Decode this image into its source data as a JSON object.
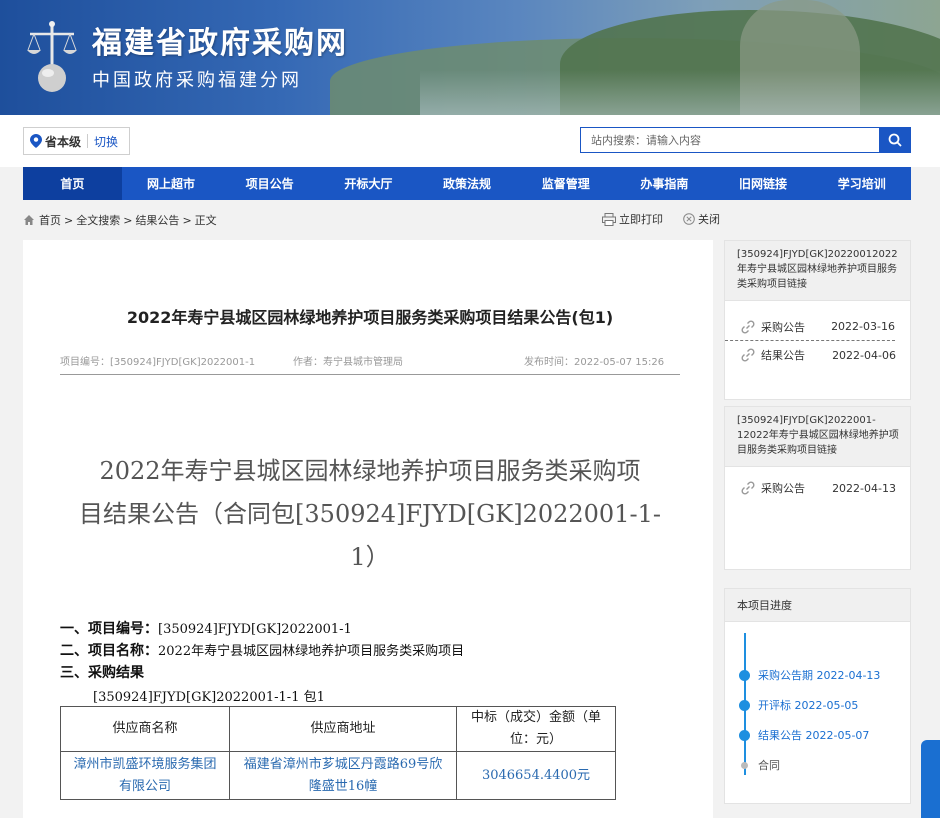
{
  "header": {
    "title": "福建省政府采购网",
    "subtitle": "中国政府采购福建分网"
  },
  "region": {
    "level": "省本级",
    "switch_label": "切换"
  },
  "search": {
    "placeholder": "站内搜索：请输入内容"
  },
  "nav": [
    {
      "label": "首页"
    },
    {
      "label": "网上超市"
    },
    {
      "label": "项目公告"
    },
    {
      "label": "开标大厅"
    },
    {
      "label": "政策法规"
    },
    {
      "label": "监督管理"
    },
    {
      "label": "办事指南"
    },
    {
      "label": "旧网链接"
    },
    {
      "label": "学习培训"
    }
  ],
  "breadcrumb": {
    "home": "首页",
    "sep": ">",
    "c1": "全文搜索",
    "c2": "结果公告",
    "c3": "正文"
  },
  "actions": {
    "print": "立即打印",
    "close": "关闭"
  },
  "article": {
    "title": "2022年寿宁县城区园林绿地养护项目服务类采购项目结果公告(包1)",
    "project_no_label": "项目编号：",
    "project_no": "[350924]FJYD[GK]2022001-1",
    "author_label": "作者：",
    "author": "寿宁县城市管理局",
    "published_label": "发布时间：",
    "published": "2022-05-07 15:26",
    "big_title_l1": "2022年寿宁县城区园林绿地养护项目服务类采购项",
    "big_title_l2": "目结果公告（合同包[350924]FJYD[GK]2022001-1-",
    "big_title_l3": "1）",
    "sec1_label": "一、项目编号：",
    "sec1_value": "[350924]FJYD[GK]2022001-1",
    "sec2_label": "二、项目名称：",
    "sec2_value": "2022年寿宁县城区园林绿地养护项目服务类采购项目",
    "sec3_label": "三、采购结果",
    "package": "[350924]FJYD[GK]2022001-1-1 包1",
    "table": {
      "h1": "供应商名称",
      "h2": "供应商地址",
      "h3_l1": "中标（成交）金额（单",
      "h3_l2": "位：元）",
      "r_name_l1": "漳州市凯盛环境服务集团",
      "r_name_l2": "有限公司",
      "r_addr_l1": "福建省漳州市芗城区丹霞路69号欣",
      "r_addr_l2": "隆盛世16幢",
      "r_amount": "3046654.4400元"
    }
  },
  "sidebar": {
    "card1": {
      "head": "[350924]FJYD[GK]20220012022年寿宁县城区园林绿地养护项目服务类采购项目链接",
      "items": [
        {
          "label": "采购公告",
          "date": "2022-03-16"
        },
        {
          "label": "结果公告",
          "date": "2022-04-06"
        }
      ]
    },
    "card2": {
      "head": "[350924]FJYD[GK]2022001-12022年寿宁县城区园林绿地养护项目服务类采购项目链接",
      "items": [
        {
          "label": "采购公告",
          "date": "2022-04-13"
        }
      ]
    },
    "progress": {
      "head": "本项目进度",
      "steps": [
        {
          "label": "采购公告期 2022-04-13"
        },
        {
          "label": "开评标 2022-05-05"
        },
        {
          "label": "结果公告 2022-05-07"
        },
        {
          "label": "合同"
        }
      ]
    }
  },
  "colors": {
    "primary": "#1a56c4",
    "nav_active": "#0d3f9f",
    "timeline": "#1e8fe0"
  }
}
